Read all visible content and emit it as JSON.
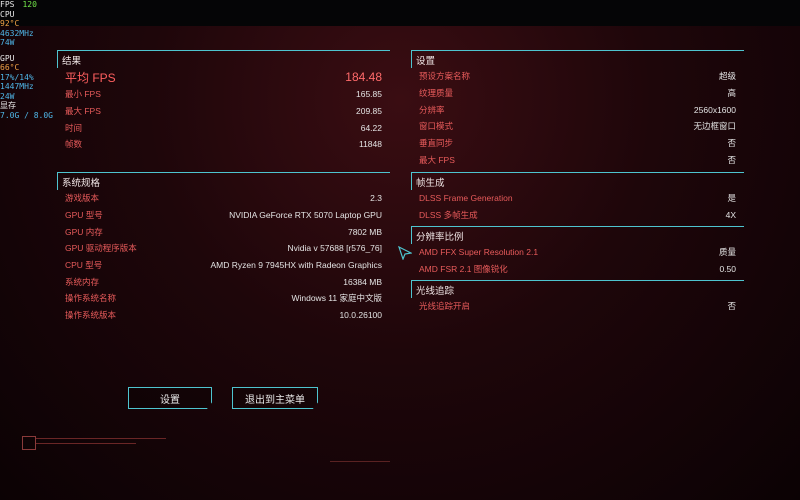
{
  "overlay": {
    "fps_label": "FPS",
    "fps_value": "120",
    "cpu_label": "CPU",
    "cpu_temp": "92°C",
    "cpu_clock": "4632MHz",
    "cpu_power": "74W",
    "gpu_label": "GPU",
    "gpu_temp": "66°C",
    "gpu_usage": "17%/14%",
    "gpu_clock": "1447MHz",
    "gpu_power": "24W",
    "vram_label": "显存",
    "vram_value": "7.0G / 8.0G"
  },
  "results": {
    "title": "结果",
    "avg_fps_label": "平均 FPS",
    "avg_fps_value": "184.48",
    "min_fps_label": "最小 FPS",
    "min_fps_value": "165.85",
    "max_fps_label": "最大 FPS",
    "max_fps_value": "209.85",
    "time_label": "时间",
    "time_value": "64.22",
    "frames_label": "帧数",
    "frames_value": "11848"
  },
  "specs": {
    "title": "系统规格",
    "items": [
      {
        "k": "游戏版本",
        "v": "2.3"
      },
      {
        "k": "GPU 型号",
        "v": "NVIDIA GeForce RTX 5070 Laptop GPU"
      },
      {
        "k": "GPU 内存",
        "v": "7802 MB"
      },
      {
        "k": "GPU 驱动程序版本",
        "v": "Nvidia v 57688 [r576_76]"
      },
      {
        "k": "CPU 型号",
        "v": "AMD Ryzen 9 7945HX with Radeon Graphics"
      },
      {
        "k": "系统内存",
        "v": "16384 MB"
      },
      {
        "k": "操作系统名称",
        "v": "Windows 11 家庭中文版"
      },
      {
        "k": "操作系统版本",
        "v": "10.0.26100"
      }
    ]
  },
  "settings": {
    "title": "设置",
    "items": [
      {
        "k": "预设方案名称",
        "v": "超级"
      },
      {
        "k": "纹理质量",
        "v": "高"
      },
      {
        "k": "分辨率",
        "v": "2560x1600"
      },
      {
        "k": "窗口模式",
        "v": "无边框窗口"
      },
      {
        "k": "垂直同步",
        "v": "否"
      },
      {
        "k": "最大 FPS",
        "v": "否"
      }
    ]
  },
  "framegen": {
    "title": "帧生成",
    "items": [
      {
        "k": "DLSS Frame Generation",
        "v": "是"
      },
      {
        "k": "DLSS 多帧生成",
        "v": "4X"
      }
    ]
  },
  "resscale": {
    "title": "分辨率比例",
    "items": [
      {
        "k": "AMD FFX Super Resolution 2.1",
        "v": "质量"
      },
      {
        "k": "AMD FSR 2.1 图像锐化",
        "v": "0.50"
      }
    ]
  },
  "raytracing": {
    "title": "光线追踪",
    "items": [
      {
        "k": "光线追踪开启",
        "v": "否"
      }
    ]
  },
  "buttons": {
    "settings": "设置",
    "exit": "退出到主菜单"
  },
  "colors": {
    "accent_cyan": "#4ec4cf",
    "label_red": "#e85b5b",
    "fps_green": "#74e84a"
  }
}
